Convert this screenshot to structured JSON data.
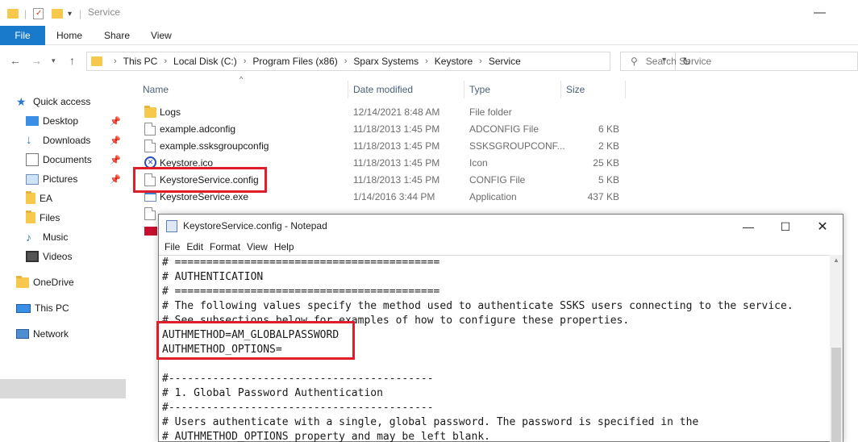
{
  "window": {
    "title": "Service"
  },
  "ribbon": {
    "tabs": [
      "File",
      "Home",
      "Share",
      "View"
    ]
  },
  "address": {
    "crumbs": [
      "This PC",
      "Local Disk (C:)",
      "Program Files (x86)",
      "Sparx Systems",
      "Keystore",
      "Service"
    ]
  },
  "search": {
    "placeholder": "Search Service"
  },
  "nav": {
    "items": [
      {
        "label": "Quick access",
        "icon": "star-icon",
        "pinned": false
      },
      {
        "label": "Desktop",
        "icon": "desktop-icon",
        "pinned": true
      },
      {
        "label": "Downloads",
        "icon": "download-icon",
        "pinned": true
      },
      {
        "label": "Documents",
        "icon": "documents-icon",
        "pinned": true
      },
      {
        "label": "Pictures",
        "icon": "pictures-icon",
        "pinned": true
      },
      {
        "label": "EA",
        "icon": "folder-icon",
        "pinned": false
      },
      {
        "label": "Files",
        "icon": "folder-icon",
        "pinned": false
      },
      {
        "label": "Music",
        "icon": "music-icon",
        "pinned": false
      },
      {
        "label": "Videos",
        "icon": "videos-icon",
        "pinned": false
      },
      {
        "label": "OneDrive",
        "icon": "folder-icon",
        "pinned": false
      },
      {
        "label": "This PC",
        "icon": "computer-icon",
        "pinned": false
      },
      {
        "label": "Network",
        "icon": "network-icon",
        "pinned": false
      }
    ]
  },
  "columns": {
    "name": "Name",
    "date": "Date modified",
    "type": "Type",
    "size": "Size"
  },
  "files": [
    {
      "name": "Logs",
      "date": "12/14/2021 8:48 AM",
      "type": "File folder",
      "size": "",
      "icon": "folder-icon"
    },
    {
      "name": "example.adconfig",
      "date": "11/18/2013 1:45 PM",
      "type": "ADCONFIG File",
      "size": "6 KB",
      "icon": "file-icon"
    },
    {
      "name": "example.ssksgroupconfig",
      "date": "11/18/2013 1:45 PM",
      "type": "SSKSGROUPCONF...",
      "size": "2 KB",
      "icon": "file-icon"
    },
    {
      "name": "Keystore.ico",
      "date": "11/18/2013 1:45 PM",
      "type": "Icon",
      "size": "25 KB",
      "icon": "keystore-icon"
    },
    {
      "name": "KeystoreService.config",
      "date": "11/18/2013 1:45 PM",
      "type": "CONFIG File",
      "size": "5 KB",
      "icon": "file-icon"
    },
    {
      "name": "KeystoreService.exe",
      "date": "1/14/2016 3:44 PM",
      "type": "Application",
      "size": "437 KB",
      "icon": "application-icon"
    }
  ],
  "notepad": {
    "title": "KeystoreService.config - Notepad",
    "menu": [
      "File",
      "Edit",
      "Format",
      "View",
      "Help"
    ],
    "lines": [
      "# ==========================================",
      "# AUTHENTICATION",
      "# ==========================================",
      "# The following values specify the method used to authenticate SSKS users connecting to the service.",
      "# See subsections below for examples of how to configure these properties.",
      "AUTHMETHOD=AM_GLOBALPASSWORD",
      "AUTHMETHOD_OPTIONS=",
      "",
      "#------------------------------------------",
      "# 1. Global Password Authentication",
      "#------------------------------------------",
      "# Users authenticate with a single, global password. The password is specified in the",
      "# AUTHMETHOD_OPTIONS property and may be left blank."
    ]
  },
  "colors": {
    "accent": "#1979ca",
    "highlight": "#e01e2a",
    "folder": "#f6c94d"
  }
}
